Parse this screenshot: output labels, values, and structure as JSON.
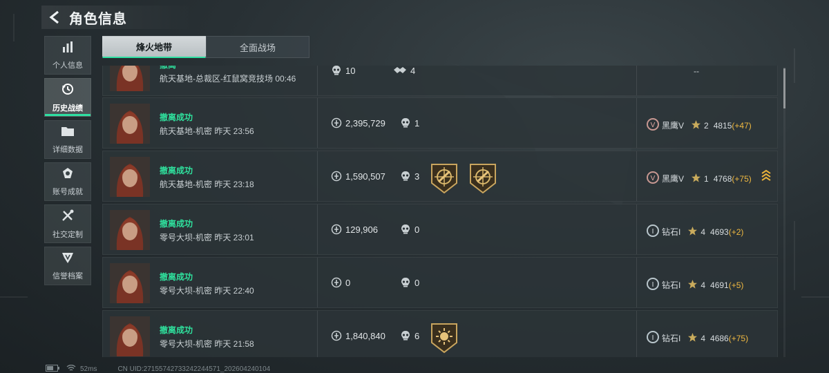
{
  "header": {
    "title": "角色信息"
  },
  "sidebar": {
    "items": [
      {
        "label": "个人信息",
        "icon": "bar-chart-icon",
        "active": false
      },
      {
        "label": "历史战绩",
        "icon": "history-clock-icon",
        "active": true
      },
      {
        "label": "详细数据",
        "icon": "folder-icon",
        "active": false
      },
      {
        "label": "账号成就",
        "icon": "medal-icon",
        "active": false
      },
      {
        "label": "社交定制",
        "icon": "tools-icon",
        "active": false
      },
      {
        "label": "信誉档案",
        "icon": "shield-emblem-icon",
        "active": false
      }
    ]
  },
  "tabs": [
    {
      "label": "烽火地带",
      "active": true
    },
    {
      "label": "全面战场",
      "active": false
    }
  ],
  "records": [
    {
      "status": "撤离",
      "map": "航天基地-总裁区-红鼠窝竞技场 00:46",
      "value": "10",
      "value_icon": "skull-icon",
      "kills": "4",
      "kills_icon": "handshake-icon",
      "badges": [],
      "rank_text": "--"
    },
    {
      "status": "撤离成功",
      "map": "航天基地-机密 昨天 23:56",
      "value": "2,395,729",
      "value_icon": "coin-icon",
      "kills": "1",
      "kills_icon": "skull-icon",
      "badges": [],
      "rank_emblem": "V",
      "rank_name": "黑鹰V",
      "level": "2",
      "score": "4815",
      "delta": "(+47)"
    },
    {
      "status": "撤离成功",
      "map": "航天基地-机密 昨天 23:18",
      "value": "1,590,507",
      "value_icon": "coin-icon",
      "kills": "3",
      "kills_icon": "skull-icon",
      "badges": [
        "crosshair-shield-badge-icon",
        "crosshair-shield-badge-icon"
      ],
      "rank_emblem": "V",
      "rank_name": "黑鹰V",
      "level": "1",
      "score": "4768",
      "delta": "(+75)",
      "chevron": true
    },
    {
      "status": "撤离成功",
      "map": "零号大坝-机密 昨天 23:01",
      "value": "129,906",
      "value_icon": "coin-icon",
      "kills": "0",
      "kills_icon": "skull-icon",
      "badges": [],
      "rank_emblem": "I",
      "rank_name": "钻石I",
      "level": "4",
      "score": "4693",
      "delta": "(+2)"
    },
    {
      "status": "撤离成功",
      "map": "零号大坝-机密 昨天 22:40",
      "value": "0",
      "value_icon": "coin-icon",
      "kills": "0",
      "kills_icon": "skull-icon",
      "badges": [],
      "rank_emblem": "I",
      "rank_name": "钻石I",
      "level": "4",
      "score": "4691",
      "delta": "(+5)"
    },
    {
      "status": "撤离成功",
      "map": "零号大坝-机密 昨天 21:58",
      "value": "1,840,840",
      "value_icon": "coin-icon",
      "kills": "6",
      "kills_icon": "skull-icon",
      "badges": [
        "sun-shield-badge-icon"
      ],
      "rank_emblem": "I",
      "rank_name": "钻石I",
      "level": "4",
      "score": "4686",
      "delta": "(+75)"
    }
  ],
  "statusbar": {
    "ping": "52ms",
    "uid": "CN UID:271557427332422445​71_202604240104"
  },
  "colors": {
    "accent": "#2ee0a2",
    "delta": "#f0b941",
    "panel": "#2c3438"
  }
}
